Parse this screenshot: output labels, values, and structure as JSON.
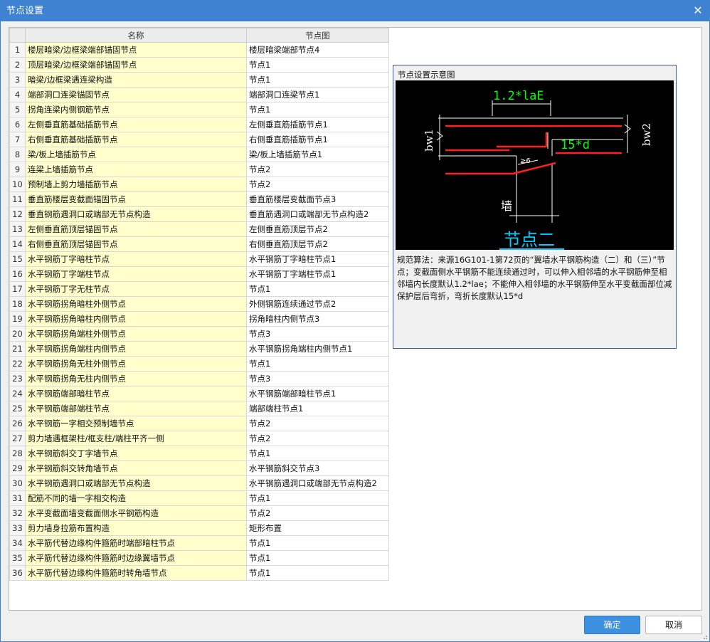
{
  "window": {
    "title": "节点设置",
    "close_glyph": "✕"
  },
  "table": {
    "columns": [
      "名称",
      "节点图"
    ],
    "rows": [
      {
        "idx": "1",
        "name": "楼层暗梁/边框梁端部锚固节点",
        "node": "楼层暗梁端部节点4"
      },
      {
        "idx": "2",
        "name": "顶层暗梁/边框梁端部锚固节点",
        "node": "节点1"
      },
      {
        "idx": "3",
        "name": "暗梁/边框梁遇连梁构造",
        "node": "节点1"
      },
      {
        "idx": "4",
        "name": "端部洞口连梁锚固节点",
        "node": "端部洞口连梁节点1"
      },
      {
        "idx": "5",
        "name": "拐角连梁内侧钢筋节点",
        "node": "节点1"
      },
      {
        "idx": "6",
        "name": "左侧垂直筋基础插筋节点",
        "node": "左侧垂直筋插筋节点1"
      },
      {
        "idx": "7",
        "name": "右侧垂直筋基础插筋节点",
        "node": "右侧垂直筋插筋节点1"
      },
      {
        "idx": "8",
        "name": "梁/板上墙插筋节点",
        "node": "梁/板上墙插筋节点1"
      },
      {
        "idx": "9",
        "name": "连梁上墙插筋节点",
        "node": "节点2"
      },
      {
        "idx": "10",
        "name": "预制墙上剪力墙插筋节点",
        "node": "节点2"
      },
      {
        "idx": "11",
        "name": "垂直筋楼层变截面锚固节点",
        "node": "垂直筋楼层变截面节点3"
      },
      {
        "idx": "12",
        "name": "垂直钢筋遇洞口或端部无节点构造",
        "node": "垂直筋遇洞口或端部无节点构造2"
      },
      {
        "idx": "13",
        "name": "左侧垂直筋顶层锚固节点",
        "node": "左侧垂直筋顶层节点2"
      },
      {
        "idx": "14",
        "name": "右侧垂直筋顶层锚固节点",
        "node": "右侧垂直筋顶层节点2"
      },
      {
        "idx": "15",
        "name": "水平钢筋丁字暗柱节点",
        "node": "水平钢筋丁字暗柱节点1"
      },
      {
        "idx": "16",
        "name": "水平钢筋丁字端柱节点",
        "node": "水平钢筋丁字端柱节点1"
      },
      {
        "idx": "17",
        "name": "水平钢筋丁字无柱节点",
        "node": "节点1"
      },
      {
        "idx": "18",
        "name": "水平钢筋拐角暗柱外侧节点",
        "node": "外侧钢筋连续通过节点2"
      },
      {
        "idx": "19",
        "name": "水平钢筋拐角暗柱内侧节点",
        "node": "拐角暗柱内侧节点3"
      },
      {
        "idx": "20",
        "name": "水平钢筋拐角端柱外侧节点",
        "node": "节点3"
      },
      {
        "idx": "21",
        "name": "水平钢筋拐角端柱内侧节点",
        "node": "水平钢筋拐角端柱内侧节点1"
      },
      {
        "idx": "22",
        "name": "水平钢筋拐角无柱外侧节点",
        "node": "节点1"
      },
      {
        "idx": "23",
        "name": "水平钢筋拐角无柱内侧节点",
        "node": "节点3"
      },
      {
        "idx": "24",
        "name": "水平钢筋端部暗柱节点",
        "node": "水平钢筋端部暗柱节点1"
      },
      {
        "idx": "25",
        "name": "水平钢筋端部端柱节点",
        "node": "端部端柱节点1"
      },
      {
        "idx": "26",
        "name": "水平钢筋一字相交预制墙节点",
        "node": "节点2"
      },
      {
        "idx": "27",
        "name": "剪力墙遇框架柱/框支柱/端柱平齐一侧",
        "node": "节点2"
      },
      {
        "idx": "28",
        "name": "水平钢筋斜交丁字墙节点",
        "node": "节点1"
      },
      {
        "idx": "29",
        "name": "水平钢筋斜交转角墙节点",
        "node": "水平钢筋斜交节点3"
      },
      {
        "idx": "30",
        "name": "水平钢筋遇洞口或端部无节点构造",
        "node": "水平钢筋遇洞口或端部无节点构造2"
      },
      {
        "idx": "31",
        "name": "配筋不同的墙一字相交构造",
        "node": "节点1"
      },
      {
        "idx": "32",
        "name": "水平变截面墙变截面侧水平钢筋构造",
        "node": "节点2"
      },
      {
        "idx": "33",
        "name": "剪力墙身拉筋布置构造",
        "node": "矩形布置"
      },
      {
        "idx": "34",
        "name": "水平筋代替边缘构件箍筋时端部暗柱节点",
        "node": "节点1"
      },
      {
        "idx": "35",
        "name": "水平筋代替边缘构件箍筋时边缘翼墙节点",
        "node": "节点1"
      },
      {
        "idx": "36",
        "name": "水平筋代替边缘构件箍筋时转角墙节点",
        "node": "节点1"
      }
    ]
  },
  "preview": {
    "title": "节点设置示意图",
    "diagram": {
      "label_top": "1.2*laE",
      "label_right": "15*d",
      "label_bw1": "bw1",
      "label_bw2": "bw2",
      "label_wall": "墙",
      "label_slope": "≥6",
      "label_node": "节点二",
      "colors": {
        "bg": "#000000",
        "dim": "#ffffff",
        "rebar": "#ff0000",
        "green": "#00ff00",
        "cyan": "#00ccff"
      }
    },
    "description": "规范算法：来源16G101-1第72页的“翼墙水平钢筋构造（二）和（三）”节点；变截面侧水平钢筋不能连续通过时，可以伸入相邻墙的水平钢筋伸至相邻墙内长度默认1.2*lae；不能伸入相邻墙的水平钢筋伸至水平变截面部位减保护层后弯折，弯折长度默认15*d"
  },
  "buttons": {
    "ok": "确定",
    "cancel": "取消"
  }
}
